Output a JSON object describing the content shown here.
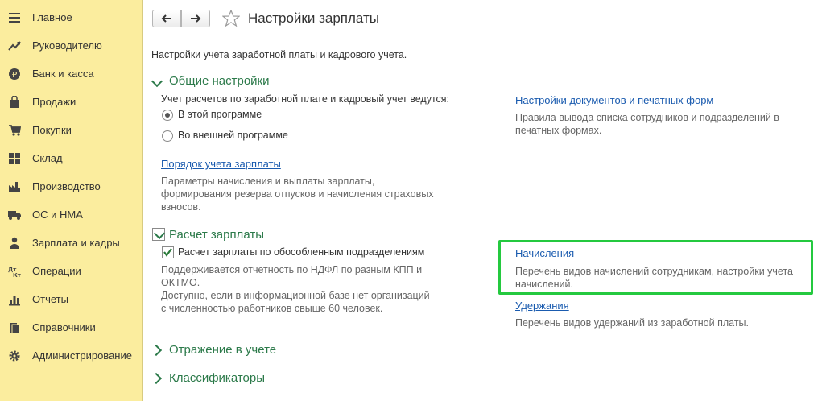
{
  "sidebar": {
    "items": [
      {
        "label": "Главное",
        "icon": "menu-icon"
      },
      {
        "label": "Руководителю",
        "icon": "trend-icon"
      },
      {
        "label": "Банк и касса",
        "icon": "ruble-icon"
      },
      {
        "label": "Продажи",
        "icon": "bag-icon"
      },
      {
        "label": "Покупки",
        "icon": "cart-icon"
      },
      {
        "label": "Склад",
        "icon": "warehouse-icon"
      },
      {
        "label": "Производство",
        "icon": "factory-icon"
      },
      {
        "label": "ОС и НМА",
        "icon": "truck-icon"
      },
      {
        "label": "Зарплата и кадры",
        "icon": "person-icon"
      },
      {
        "label": "Операции",
        "icon": "dt-kt-icon"
      },
      {
        "label": "Отчеты",
        "icon": "bar-chart-icon"
      },
      {
        "label": "Справочники",
        "icon": "books-icon"
      },
      {
        "label": "Администрирование",
        "icon": "gear-icon"
      }
    ]
  },
  "header": {
    "title": "Настройки зарплаты"
  },
  "main": {
    "intro": "Настройки учета заработной платы и кадрового учета.",
    "general": {
      "title": "Общие настройки",
      "question": "Учет расчетов по заработной плате и кадровый учет ведутся:",
      "option1": "В этой программе",
      "option2": "Во внешней программе",
      "selected": "option1",
      "order_link": "Порядок учета зарплаты",
      "order_desc_1": "Параметры начисления и выплаты зарплаты,",
      "order_desc_2": "формирования резерва отпусков и начисления страховых",
      "order_desc_3": "взносов.",
      "docs_link": "Настройки документов и печатных форм",
      "docs_desc_1": "Правила вывода списка сотрудников и подразделений в",
      "docs_desc_2": "печатных формах."
    },
    "payroll": {
      "title": "Расчет зарплаты",
      "checkbox_label": "Расчет зарплаты по обособленным подразделениям",
      "checked": true,
      "desc_1": "Поддерживается отчетность по НДФЛ по разным КПП и",
      "desc_2": "ОКТМО.",
      "desc_3": "Доступно, если в информационной базе нет организаций",
      "desc_4": "с численностью работников свыше 60 человек.",
      "accruals_link": "Начисления",
      "accruals_desc_1": "Перечень видов начислений сотрудникам, настройки учета",
      "accruals_desc_2": "начислений.",
      "deductions_link": "Удержания",
      "deductions_desc": "Перечень видов удержаний из заработной платы."
    },
    "accounting": {
      "title": "Отражение в учете"
    },
    "classifiers": {
      "title": "Классификаторы"
    }
  },
  "colors": {
    "sidebar_bg": "#fbed9e",
    "section": "#2c7a4a",
    "link": "#1a5baf",
    "highlight": "#24c93f"
  }
}
